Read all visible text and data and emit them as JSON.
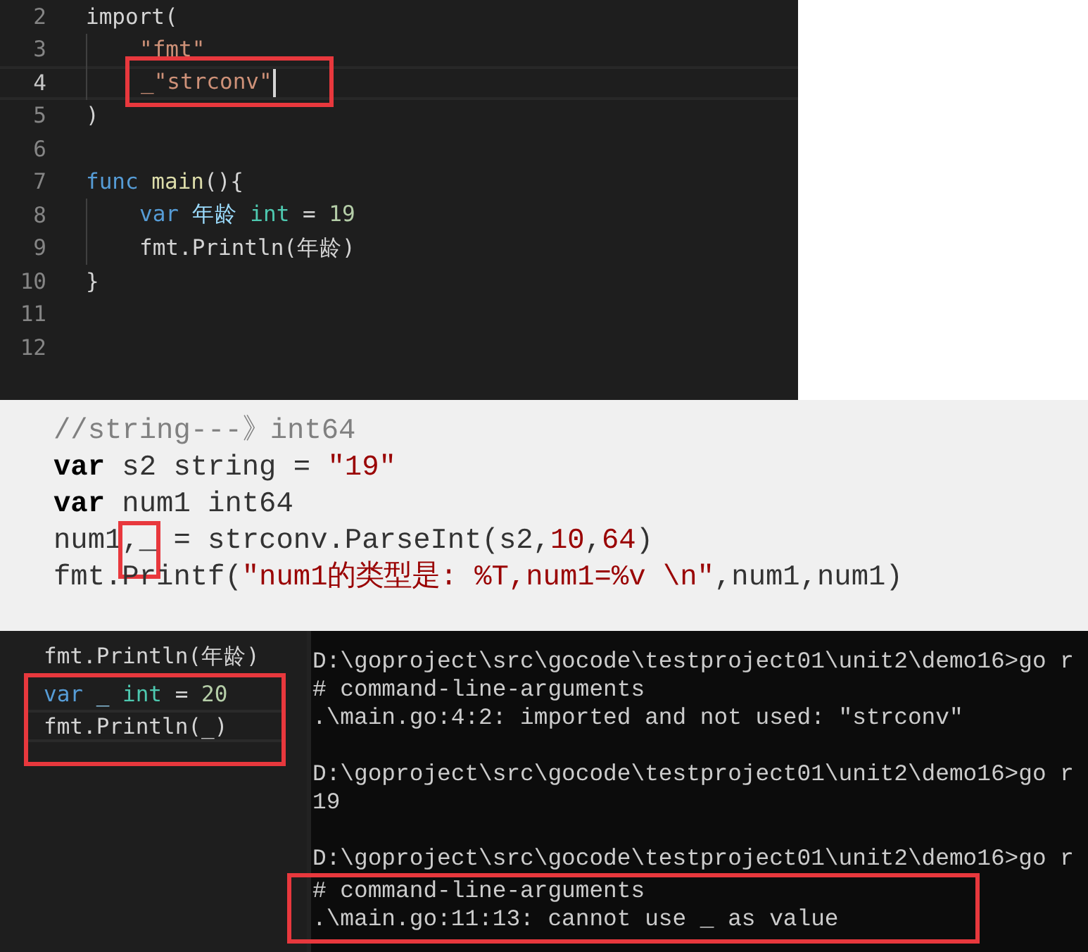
{
  "editor_top": {
    "lines": [
      {
        "number": "2",
        "current": false,
        "indent": false,
        "tokens": [
          {
            "text": "import(",
            "kind": "plain"
          }
        ]
      },
      {
        "number": "3",
        "current": false,
        "indent": true,
        "tokens": [
          {
            "text": "\"fmt\"",
            "kind": "string"
          }
        ]
      },
      {
        "number": "4",
        "current": true,
        "indent": true,
        "tokens": [
          {
            "text": "_\"strconv\"",
            "kind": "string",
            "boxed": true,
            "cursor": true
          }
        ]
      },
      {
        "number": "5",
        "current": false,
        "indent": false,
        "tokens": [
          {
            "text": ")",
            "kind": "plain"
          }
        ]
      },
      {
        "number": "6",
        "current": false,
        "indent": false
      },
      {
        "number": "7",
        "current": false,
        "indent": false,
        "tokens": [
          {
            "text": "func",
            "kind": "keyword"
          },
          {
            "text": " main",
            "kind": "func"
          },
          {
            "text": "(){",
            "kind": "plain"
          }
        ]
      },
      {
        "number": "8",
        "current": false,
        "indent": true,
        "tokens": [
          {
            "text": "var",
            "kind": "keyword"
          },
          {
            "text": " 年龄 ",
            "kind": "ident"
          },
          {
            "text": "int",
            "kind": "type"
          },
          {
            "text": " = ",
            "kind": "plain"
          },
          {
            "text": "19",
            "kind": "number"
          }
        ]
      },
      {
        "number": "9",
        "current": false,
        "indent": true,
        "tokens": [
          {
            "text": "fmt.Println(年龄)",
            "kind": "plain"
          }
        ]
      },
      {
        "number": "10",
        "current": false,
        "indent": false,
        "tokens": [
          {
            "text": "}",
            "kind": "plain"
          }
        ]
      },
      {
        "number": "11",
        "current": false,
        "indent": false
      },
      {
        "number": "12",
        "current": false,
        "indent": false
      }
    ]
  },
  "snippet": {
    "lines": [
      {
        "tokens": [
          {
            "text": "//string---》int64",
            "kind": "comment"
          }
        ]
      },
      {
        "tokens": [
          {
            "text": "var",
            "kind": "bold"
          },
          {
            "text": " s2 string = ",
            "kind": "plain"
          },
          {
            "text": "\"19\"",
            "kind": "string"
          }
        ]
      },
      {
        "tokens": [
          {
            "text": "var",
            "kind": "bold"
          },
          {
            "text": " num1 int64",
            "kind": "plain"
          }
        ]
      },
      {
        "tokens": [
          {
            "text": "num1",
            "kind": "plain"
          },
          {
            "text": ",_",
            "kind": "plain",
            "boxed": true
          },
          {
            "text": " = strconv.ParseInt(s2,",
            "kind": "plain"
          },
          {
            "text": "10",
            "kind": "number"
          },
          {
            "text": ",",
            "kind": "plain"
          },
          {
            "text": "64",
            "kind": "number"
          },
          {
            "text": ")",
            "kind": "plain"
          }
        ]
      },
      {
        "tokens": [
          {
            "text": "fmt.Printf(",
            "kind": "plain"
          },
          {
            "text": "\"num1的类型是: %T,num1=%v \\n\"",
            "kind": "string"
          },
          {
            "text": ",num1,num1)",
            "kind": "plain"
          }
        ]
      }
    ]
  },
  "editor_bottom": {
    "lines": [
      {
        "current": false,
        "boxed": false,
        "tokens": [
          {
            "text": "fmt.Println(年龄)",
            "kind": "plain"
          }
        ]
      },
      {
        "current": false,
        "boxed": true,
        "tokens": [
          {
            "text": "var",
            "kind": "keyword"
          },
          {
            "text": " _ ",
            "kind": "ident"
          },
          {
            "text": "int",
            "kind": "type"
          },
          {
            "text": " = ",
            "kind": "plain"
          },
          {
            "text": "20",
            "kind": "number"
          }
        ]
      },
      {
        "current": true,
        "boxed": true,
        "tokens": [
          {
            "text": "fmt.Println(_)",
            "kind": "plain"
          }
        ]
      }
    ]
  },
  "terminal": {
    "blocks": [
      {
        "lines": [
          {
            "text": "D:\\goproject\\src\\gocode\\testproject01\\unit2\\demo16>go r",
            "boxed": false
          },
          {
            "text": "# command-line-arguments",
            "boxed": false
          },
          {
            "text": ".\\main.go:4:2: imported and not used: ″strconv″",
            "boxed": false
          }
        ]
      },
      {
        "lines": [
          {
            "text": "D:\\goproject\\src\\gocode\\testproject01\\unit2\\demo16>go r",
            "boxed": false
          },
          {
            "text": "19",
            "boxed": false
          }
        ]
      },
      {
        "lines": [
          {
            "text": "D:\\goproject\\src\\gocode\\testproject01\\unit2\\demo16>go r",
            "boxed": false
          },
          {
            "text": "# command-line-arguments",
            "boxed": true
          },
          {
            "text": ".\\main.go:11:13: cannot use _ as value",
            "boxed": true
          }
        ]
      }
    ]
  }
}
